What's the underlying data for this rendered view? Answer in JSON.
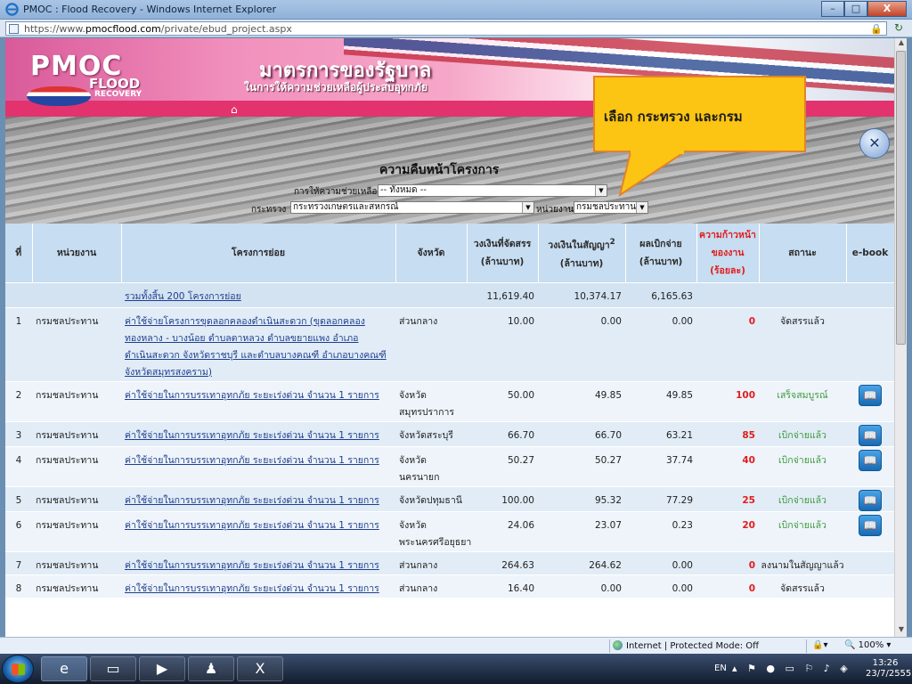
{
  "window": {
    "title": "PMOC : Flood Recovery - Windows Internet Explorer",
    "min": "–",
    "max": "□",
    "close": "X"
  },
  "address": {
    "scheme": "https://www.",
    "domain": "pmocflood.com",
    "path": "/private/ebud_project.aspx"
  },
  "banner": {
    "logo_main": "PMOC",
    "logo_sub": "FLOOD",
    "logo_small": "RECOVERY",
    "title": "มาตรการของรัฐบาล",
    "subtitle": "ในการให้ความช่วยเหลือผู้ประสบอุทกภัย"
  },
  "page": {
    "heading": "ความคืบหน้าโครงการ",
    "assist_label": "การให้ความช่วยเหลือ",
    "assist_value": "-- ทั้งหมด --",
    "ministry_label": "กระทรวง",
    "ministry_value": "กระทรวงเกษตรและสหกรณ์",
    "dept_label": "หน่วยงาน",
    "dept_value": "กรมชลประทาน"
  },
  "callout": {
    "text": "เลือก กระทรวง และกรม"
  },
  "table": {
    "headers": {
      "no": "ที่",
      "agency": "หน่วยงาน",
      "project": "โครงการย่อย",
      "province": "จังหวัด",
      "allocated_1": "วงเงินที่จัดสรร",
      "allocated_2": "(ล้านบาท)",
      "contract_1": "วงเงินในสัญญา",
      "contract_sup": "2",
      "contract_2": "(ล้านบาท)",
      "disbursed_1": "ผลเบิกจ่าย",
      "disbursed_2": "(ล้านบาท)",
      "progress_1": "ความก้าวหน้า",
      "progress_2": "ของงาน",
      "progress_3": "(ร้อยละ)",
      "status": "สถานะ",
      "ebook": "e-book"
    },
    "summary": {
      "label": "รวมทั้งสิ้น 200 โครงการย่อย",
      "allocated": "11,619.40",
      "contract": "10,374.17",
      "disbursed": "6,165.63"
    },
    "rows": [
      {
        "no": "1",
        "agency": "กรมชลประทาน",
        "project": "ค่าใช้จ่ายโครงการขุดลอกคลองดำเนินสะดวก (ขุดลอกคลองทองหลาง - บางน้อย ตำบลตาหลวง ตำบลขยายแพง อำเภอดำเนินสะดวก จังหวัดราชบุรี และตำบลบางคณฑี อำเภอบางคณฑี จังหวัดสมุทรสงคราม)",
        "province": "ส่วนกลาง",
        "allocated": "10.00",
        "contract": "0.00",
        "disbursed": "0.00",
        "progress": "0",
        "status": "จัดสรรแล้ว",
        "ebook": ""
      },
      {
        "no": "2",
        "agency": "กรมชลประทาน",
        "project": "ค่าใช้จ่ายในการบรรเทาอุทกภัย ระยะเร่งด่วน จำนวน 1 รายการ",
        "province": "จังหวัดสมุทรปราการ",
        "allocated": "50.00",
        "contract": "49.85",
        "disbursed": "49.85",
        "progress": "100",
        "status": "เสร็จสมบูรณ์",
        "ebook": "yes"
      },
      {
        "no": "3",
        "agency": "กรมชลประทาน",
        "project": "ค่าใช้จ่ายในการบรรเทาอุทกภัย ระยะเร่งด่วน จำนวน 1 รายการ",
        "province": "จังหวัดสระบุรี",
        "allocated": "66.70",
        "contract": "66.70",
        "disbursed": "63.21",
        "progress": "85",
        "status": "เบิกจ่ายแล้ว",
        "ebook": "yes"
      },
      {
        "no": "4",
        "agency": "กรมชลประทาน",
        "project": "ค่าใช้จ่ายในการบรรเทาอุทกภัย ระยะเร่งด่วน จำนวน 1 รายการ",
        "province": "จังหวัดนครนายก",
        "allocated": "50.27",
        "contract": "50.27",
        "disbursed": "37.74",
        "progress": "40",
        "status": "เบิกจ่ายแล้ว",
        "ebook": "yes"
      },
      {
        "no": "5",
        "agency": "กรมชลประทาน",
        "project": "ค่าใช้จ่ายในการบรรเทาอุทกภัย ระยะเร่งด่วน จำนวน 1 รายการ",
        "province": "จังหวัดปทุมธานี",
        "allocated": "100.00",
        "contract": "95.32",
        "disbursed": "77.29",
        "progress": "25",
        "status": "เบิกจ่ายแล้ว",
        "ebook": "yes"
      },
      {
        "no": "6",
        "agency": "กรมชลประทาน",
        "project": "ค่าใช้จ่ายในการบรรเทาอุทกภัย ระยะเร่งด่วน จำนวน 1 รายการ",
        "province": "จังหวัดพระนครศรีอยุธยา",
        "allocated": "24.06",
        "contract": "23.07",
        "disbursed": "0.23",
        "progress": "20",
        "status": "เบิกจ่ายแล้ว",
        "ebook": "yes"
      },
      {
        "no": "7",
        "agency": "กรมชลประทาน",
        "project": "ค่าใช้จ่ายในการบรรเทาอุทกภัย ระยะเร่งด่วน จำนวน 1 รายการ",
        "province": "ส่วนกลาง",
        "allocated": "264.63",
        "contract": "264.62",
        "disbursed": "0.00",
        "progress": "0",
        "status": "ลงนามในสัญญาแล้ว",
        "ebook": ""
      },
      {
        "no": "8",
        "agency": "กรมชลประทาน",
        "project": "ค่าใช้จ่ายในการบรรเทาอุทกภัย ระยะเร่งด่วน จำนวน 1 รายการ",
        "province": "ส่วนกลาง",
        "allocated": "16.40",
        "contract": "0.00",
        "disbursed": "0.00",
        "progress": "0",
        "status": "จัดสรรแล้ว",
        "ebook": ""
      }
    ]
  },
  "statusbar": {
    "zone": "Internet | Protected Mode: Off",
    "zoom": "100%"
  },
  "taskbar": {
    "lang": "EN",
    "time": "13:26",
    "date": "23/7/2555"
  },
  "colors": {
    "callout_fill": "#fcc413",
    "callout_border": "#e2832a",
    "header_bg": "#c7ddf1",
    "progress_red": "#e11d1d",
    "status_green": "#3e9a3e",
    "banner_pink": "#e2336f"
  }
}
